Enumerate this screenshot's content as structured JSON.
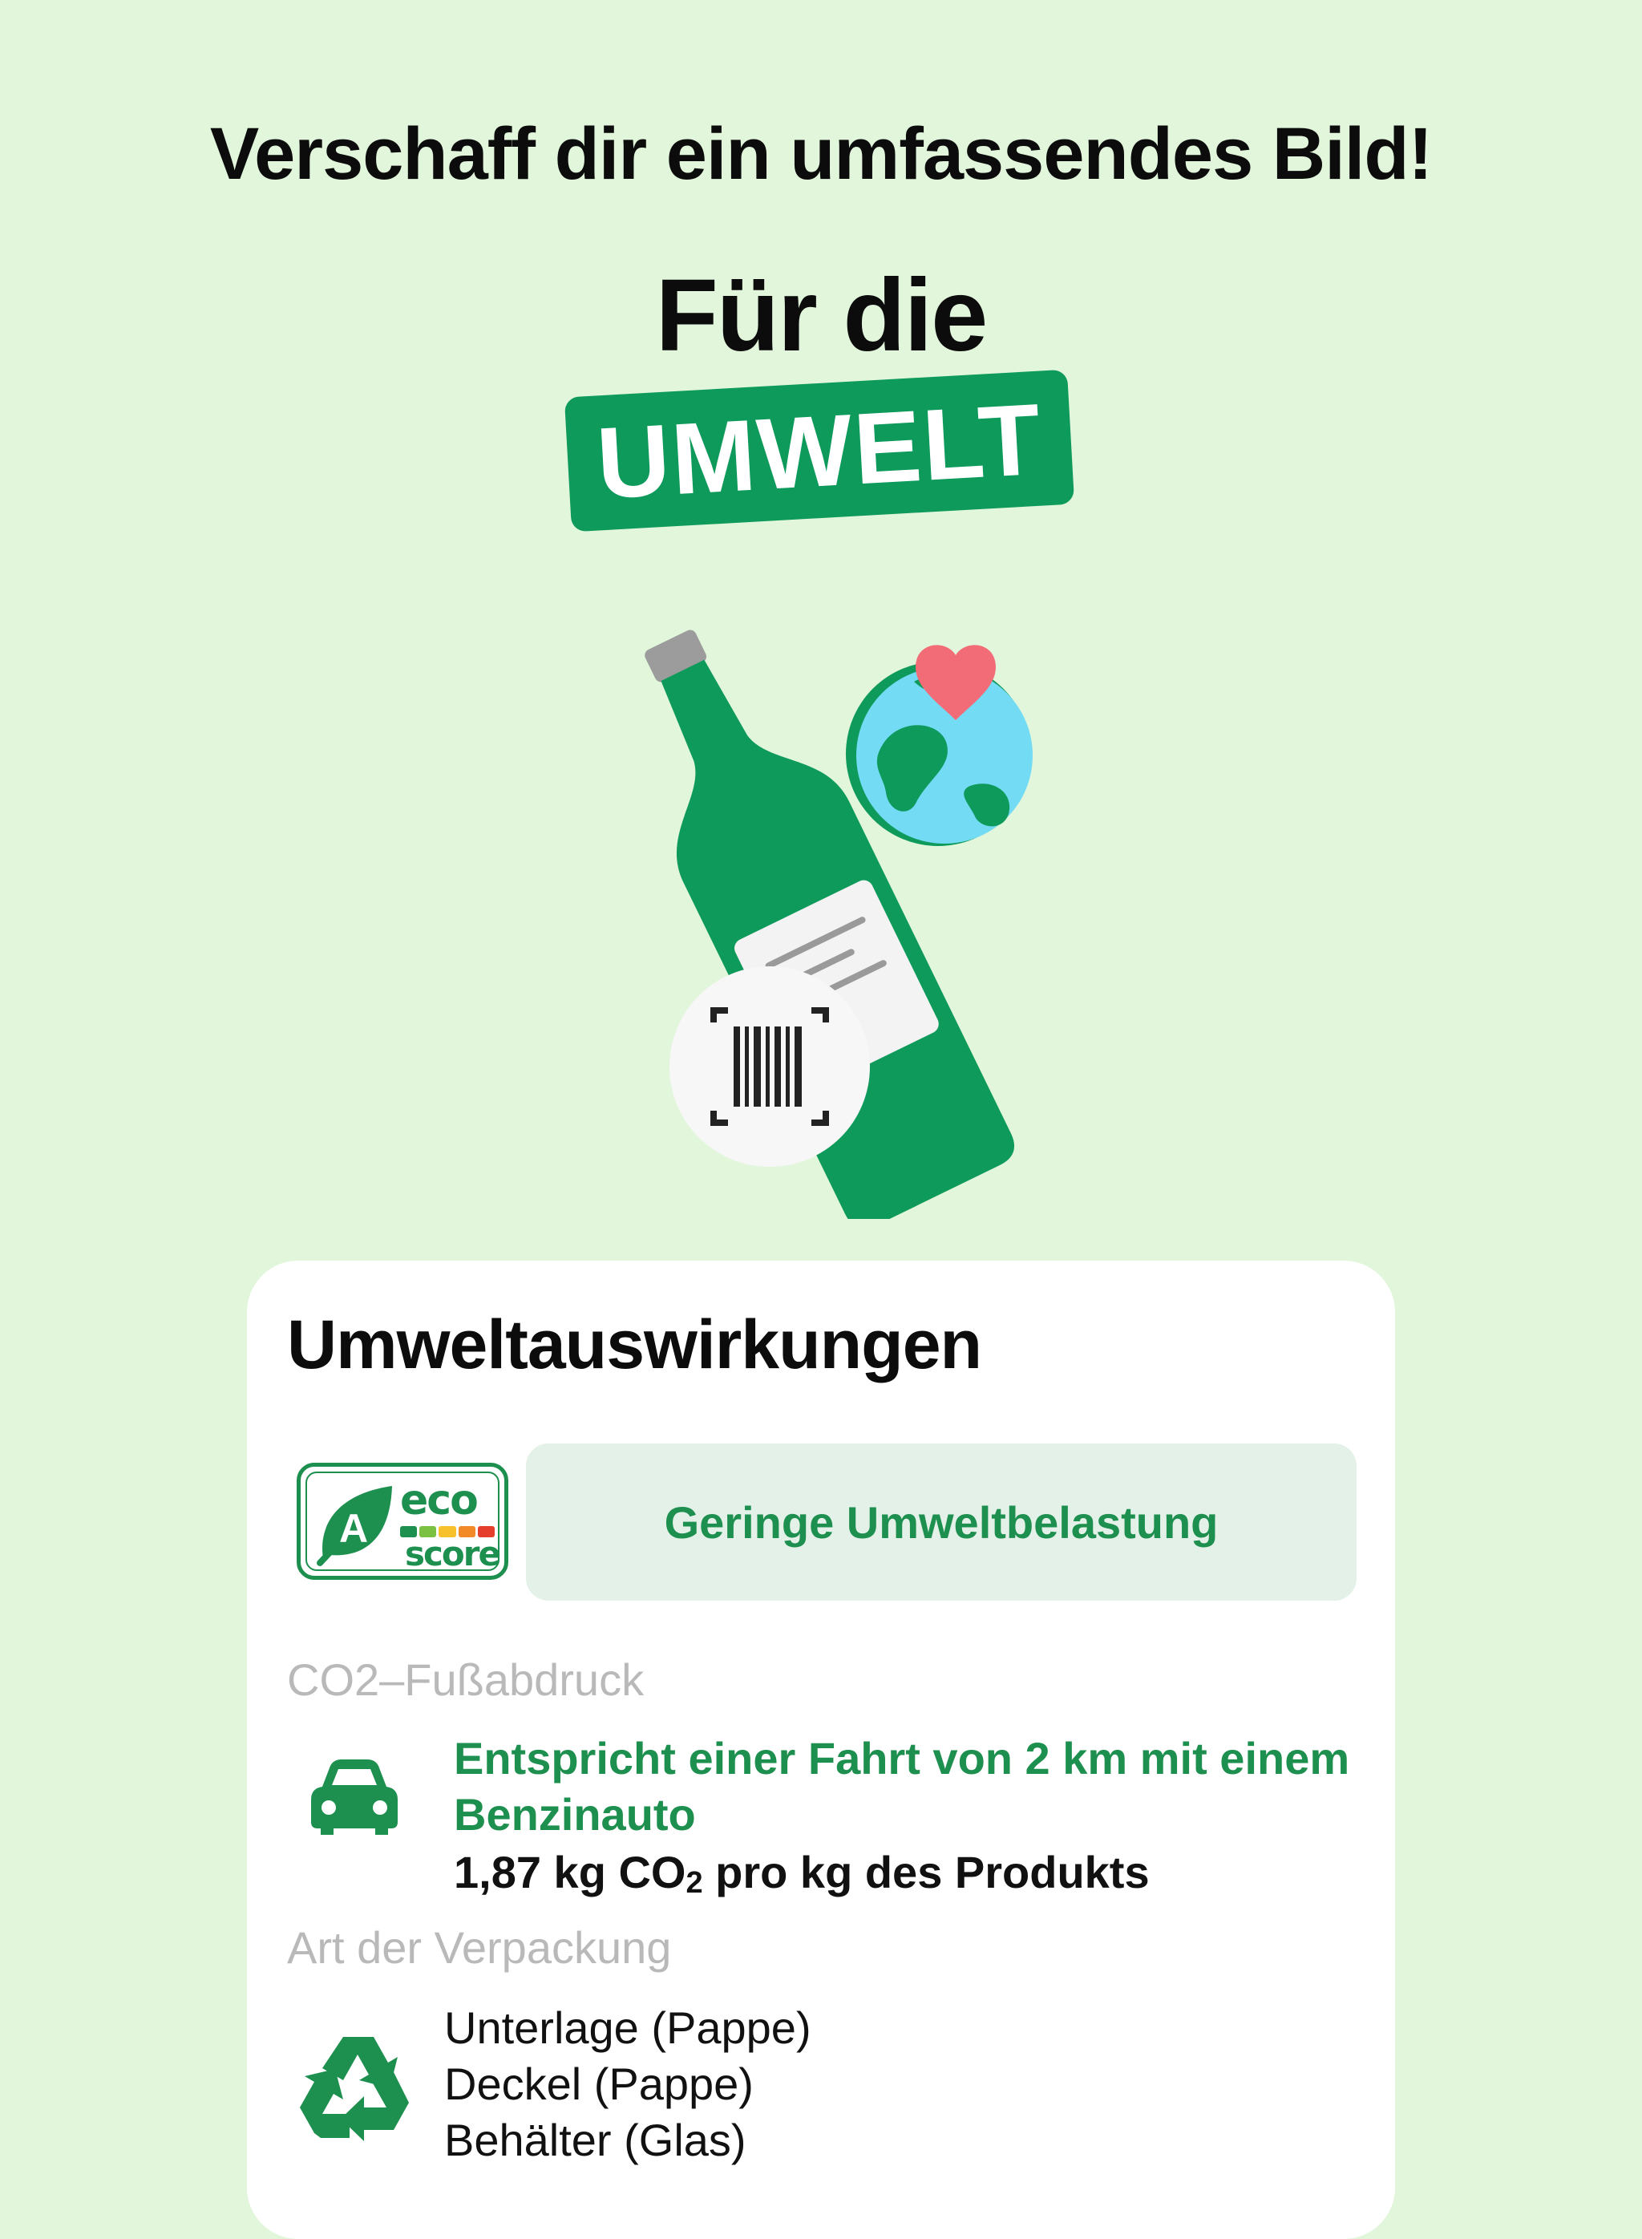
{
  "header": {
    "tagline": "Verschaff dir ein umfassendes Bild!",
    "headline": "Für die",
    "badge": "UMWELT"
  },
  "illustration": {
    "icons": [
      "bottle-icon",
      "globe-icon",
      "heart-icon",
      "barcode-scan-icon"
    ]
  },
  "card": {
    "title": "Umweltauswirkungen",
    "eco_score": {
      "grade": "A",
      "word_top": "eco",
      "word_bottom": "score",
      "colors": [
        "#1d8f4e",
        "#7ac142",
        "#f6c12a",
        "#f28a28",
        "#e63e2c"
      ]
    },
    "rating_label": "Geringe Umweltbelastung",
    "co2": {
      "section_label": "CO2–Fußabdruck",
      "icon": "car-icon",
      "highlight": "Entspricht einer Fahrt von 2 km mit einem Benzinauto",
      "value_prefix": "1,87 kg CO",
      "value_sub": "2",
      "value_suffix": " pro kg des Produkts"
    },
    "packaging": {
      "section_label": "Art der Verpackung",
      "icon": "recycle-icon",
      "items": [
        "Unterlage (Pappe)",
        "Deckel (Pappe)",
        "Behälter (Glas)"
      ]
    }
  },
  "colors": {
    "background": "#e2f6dc",
    "brand_green": "#0e9a5b",
    "text_green": "#1d8f4e",
    "card": "#ffffff",
    "pill": "#e4f1e8"
  }
}
